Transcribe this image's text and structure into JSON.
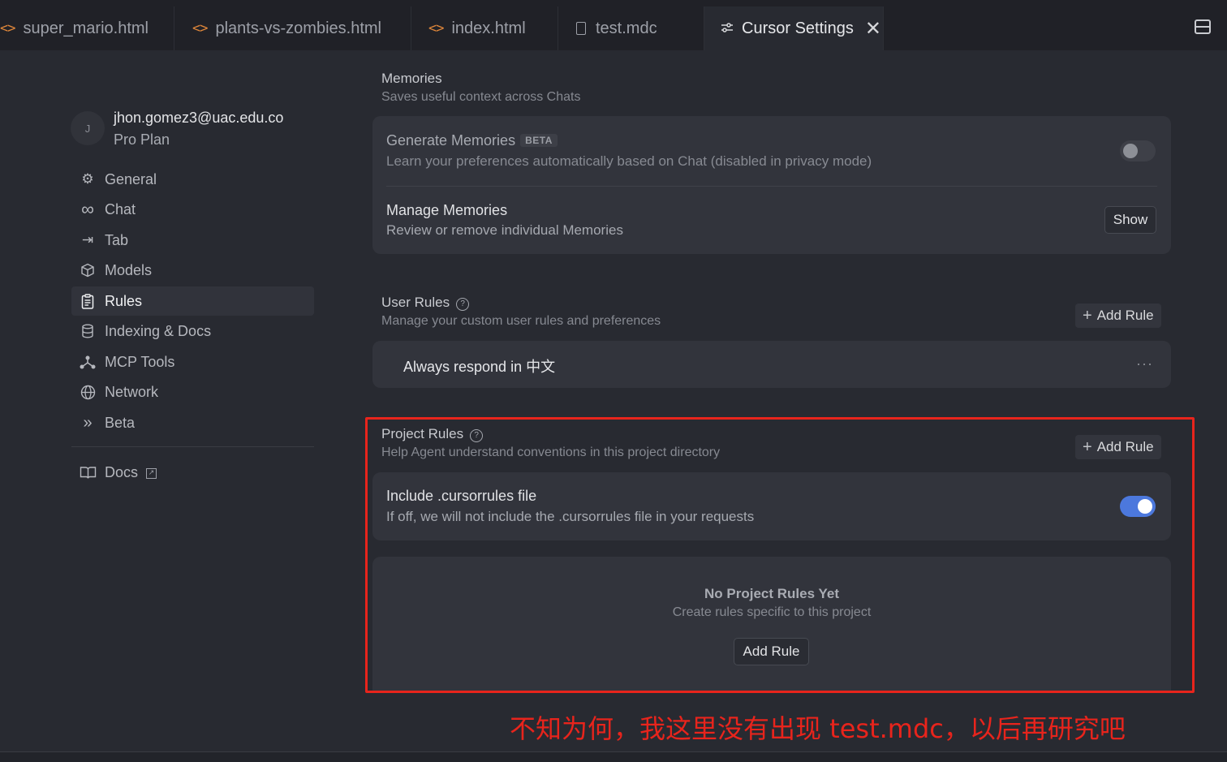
{
  "tabs": [
    {
      "label": "super_mario.html",
      "icon": "code-icon"
    },
    {
      "label": "plants-vs-zombies.html",
      "icon": "code-icon"
    },
    {
      "label": "index.html",
      "icon": "code-icon"
    },
    {
      "label": "test.mdc",
      "icon": "file-icon"
    },
    {
      "label": "Cursor Settings",
      "icon": "sliders-icon",
      "close": "✕"
    }
  ],
  "user": {
    "avatar_initial": "J",
    "email": "jhon.gomez3@uac.edu.co",
    "plan": "Pro Plan"
  },
  "sidebar": {
    "items": [
      {
        "label": "General",
        "icon": "gear-icon"
      },
      {
        "label": "Chat",
        "icon": "infinity-icon"
      },
      {
        "label": "Tab",
        "icon": "arrow-right-bar-icon"
      },
      {
        "label": "Models",
        "icon": "cube-icon"
      },
      {
        "label": "Rules",
        "icon": "clipboard-icon",
        "active": true
      },
      {
        "label": "Indexing & Docs",
        "icon": "database-icon"
      },
      {
        "label": "MCP Tools",
        "icon": "nodes-icon"
      },
      {
        "label": "Network",
        "icon": "globe-icon"
      },
      {
        "label": "Beta",
        "icon": "chevrons-right-icon"
      }
    ],
    "docs_label": "Docs"
  },
  "memories": {
    "title": "Memories",
    "subtitle": "Saves useful context across Chats",
    "generate": {
      "title": "Generate Memories",
      "badge": "BETA",
      "description": "Learn your preferences automatically based on Chat (disabled in privacy mode)",
      "enabled": false
    },
    "manage": {
      "title": "Manage Memories",
      "description": "Review or remove individual Memories",
      "button": "Show"
    }
  },
  "user_rules": {
    "title": "User Rules",
    "subtitle": "Manage your custom user rules and preferences",
    "add_button": "Add Rule",
    "rules": [
      "Always respond in 中文"
    ],
    "menu": "···"
  },
  "project_rules": {
    "title": "Project Rules",
    "subtitle": "Help Agent understand conventions in this project directory",
    "add_button": "Add Rule",
    "include": {
      "title": "Include .cursorrules file",
      "description": "If off, we will not include the .cursorrules file in your requests",
      "enabled": true
    },
    "empty": {
      "title": "No Project Rules Yet",
      "subtitle": "Create rules specific to this project",
      "button": "Add Rule"
    }
  },
  "annotation": "不知为何，我这里没有出现 test.mdc，以后再研究吧",
  "colors": {
    "annotation": "#e8241c",
    "toggle_on": "#4c78dd",
    "code_icon": "#e0873a"
  }
}
